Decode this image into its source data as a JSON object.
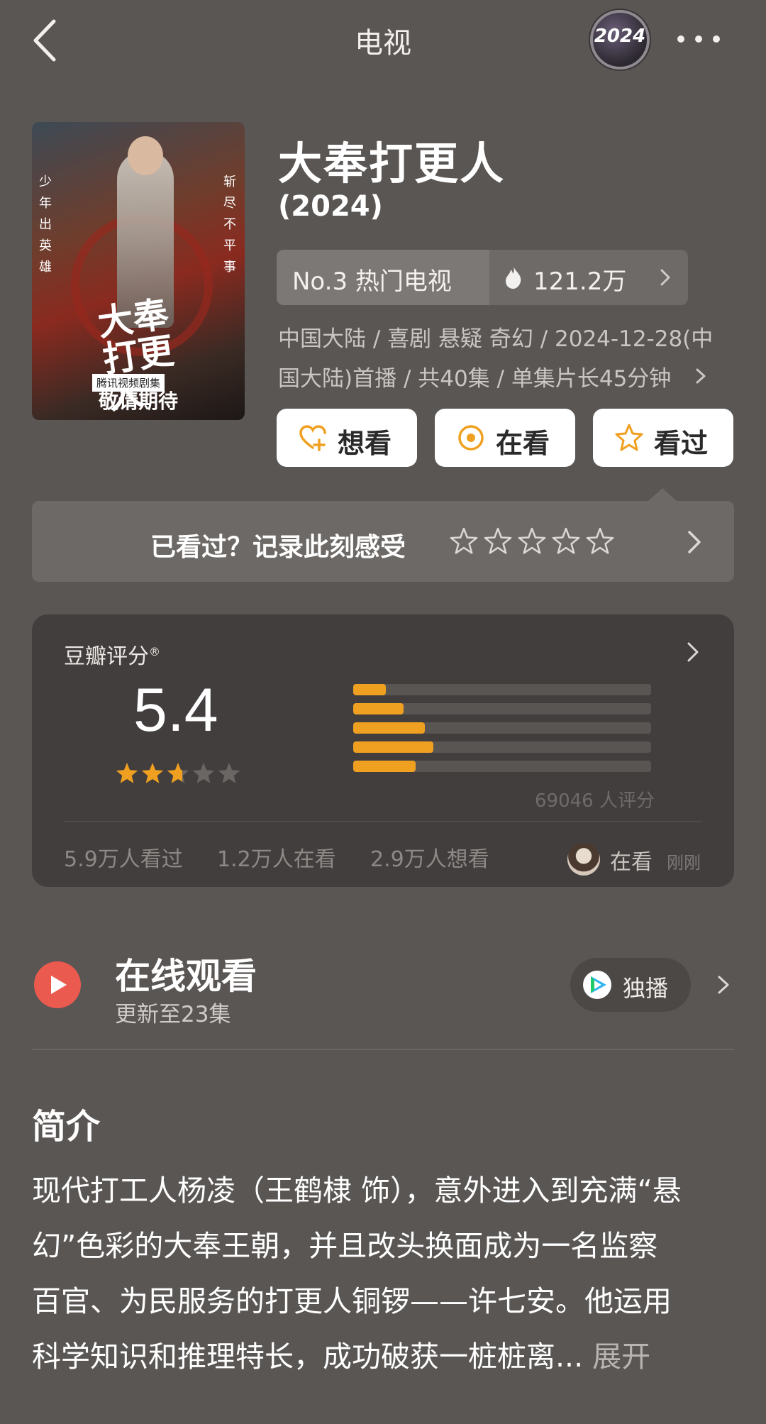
{
  "nav": {
    "title": "电视",
    "badge_text": "2024"
  },
  "poster": {
    "left_vertical": "少年出英雄",
    "right_vertical": "斩尽不平事",
    "calligraphy": "大奉打更人",
    "subtitle": "腾讯视频剧集",
    "bottom_text": "敬请期待"
  },
  "show": {
    "title": "大奉打更人",
    "year": "(2024)",
    "rank_label": "No.3 热门电视",
    "heat": "121.2万",
    "meta_line1": "中国大陆 / 喜剧 悬疑 奇幻 / 2024-12-28(中",
    "meta_line2": "国大陆)首播 / 共40集 / 单集片长45分钟"
  },
  "actions": {
    "want": "想看",
    "watching": "在看",
    "watched": "看过"
  },
  "record": {
    "prompt": "已看过？记录此刻感受"
  },
  "rating": {
    "label": "豆瓣评分",
    "reg": "®",
    "score": "5.4",
    "star_value": 2.7,
    "star_max": 5,
    "distribution": [
      {
        "stars": 5,
        "fraction": 0.11
      },
      {
        "stars": 4,
        "fraction": 0.17
      },
      {
        "stars": 3,
        "fraction": 0.24
      },
      {
        "stars": 2,
        "fraction": 0.27
      },
      {
        "stars": 1,
        "fraction": 0.21
      }
    ],
    "count_text": "69046 人评分",
    "watched_count": "5.9万人看过",
    "watching_count": "1.2万人在看",
    "want_count": "2.9万人想看",
    "friend_status": "在看",
    "friend_time": "刚刚"
  },
  "online": {
    "title": "在线观看",
    "subtitle": "更新至23集",
    "exclusive_label": "独播"
  },
  "intro": {
    "title": "简介",
    "lines": [
      "现代打工人杨凌（王鹤棣 饰），意外进入到充满“悬",
      "幻”色彩的大奉王朝，并且改头换面成为一名监察",
      "百官、为民服务的打更人铜锣——许七安。他运用",
      "科学知识和推理特长，成功破获一桩桩离..."
    ],
    "expand": "展开"
  },
  "colors": {
    "background": "#5a5654",
    "card": "#413e3d",
    "accent_orange": "#f0a020",
    "play_red": "#ea5a4f"
  }
}
